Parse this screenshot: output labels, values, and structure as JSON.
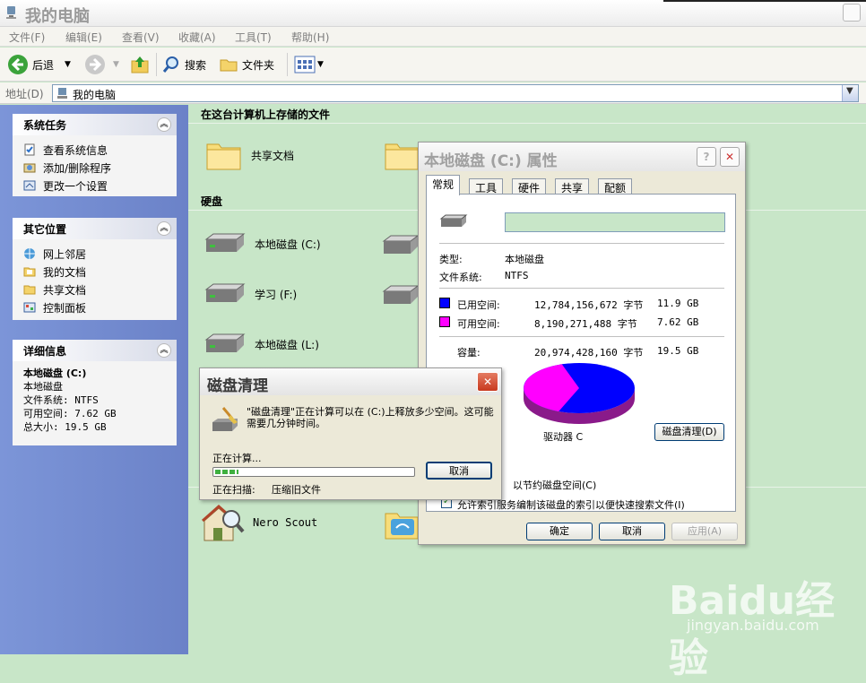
{
  "window": {
    "title": "我的电脑"
  },
  "menubar": [
    "文件(F)",
    "编辑(E)",
    "查看(V)",
    "收藏(A)",
    "工具(T)",
    "帮助(H)"
  ],
  "toolbar": {
    "back": "后退",
    "search": "搜索",
    "folders": "文件夹"
  },
  "address": {
    "label": "地址(D)",
    "value": "我的电脑"
  },
  "left": {
    "system_tasks": {
      "title": "系统任务",
      "items": [
        "查看系统信息",
        "添加/删除程序",
        "更改一个设置"
      ]
    },
    "other_places": {
      "title": "其它位置",
      "items": [
        "网上邻居",
        "我的文档",
        "共享文档",
        "控制面板"
      ]
    },
    "details": {
      "title": "详细信息",
      "name": "本地磁盘 (C:)",
      "type": "本地磁盘",
      "fs": "文件系统: NTFS",
      "free": "可用空间: 7.62 GB",
      "total": "总大小: 19.5 GB"
    }
  },
  "main": {
    "stored_header": "在这台计算机上存储的文件",
    "shared_docs": "共享文档",
    "hdd_header": "硬盘",
    "disks": [
      "本地磁盘 (C:)",
      "学习 (F:)",
      "本地磁盘 (L:)"
    ],
    "nero": "Nero Scout"
  },
  "props": {
    "title": "本地磁盘 (C:) 属性",
    "tabs": [
      "常规",
      "工具",
      "硬件",
      "共享",
      "配额"
    ],
    "type_label": "类型:",
    "type_value": "本地磁盘",
    "fs_label": "文件系统:",
    "fs_value": "NTFS",
    "used_label": "已用空间:",
    "used_bytes": "12,784,156,672 字节",
    "used_gb": "11.9 GB",
    "free_label": "可用空间:",
    "free_bytes": "8,190,271,488 字节",
    "free_gb": "7.62 GB",
    "cap_label": "容量:",
    "cap_bytes": "20,974,428,160 字节",
    "cap_gb": "19.5 GB",
    "drive_label": "驱动器 C",
    "cleanup_button": "磁盘清理(D)",
    "compress_partial": "以节约磁盘空间(C)",
    "index_partial": "允许索引服务编制该磁盘的索引以便快速搜索文件(I)",
    "ok": "确定",
    "cancel": "取消",
    "apply": "应用(A)",
    "colors": {
      "used": "#0000ff",
      "free": "#ff00ff"
    },
    "pie": {
      "used_fraction": 0.61,
      "free_fraction": 0.39
    }
  },
  "cleanup": {
    "title": "磁盘清理",
    "message": "\"磁盘清理\"正在计算可以在 (C:)上释放多少空间。这可能需要几分钟时间。",
    "calculating": "正在计算...",
    "cancel": "取消",
    "scanning_label": "正在扫描:",
    "scanning_value": "压缩旧文件",
    "progress": 0.12
  },
  "watermark": {
    "brand": "Baidu经验",
    "url": "jingyan.baidu.com"
  }
}
